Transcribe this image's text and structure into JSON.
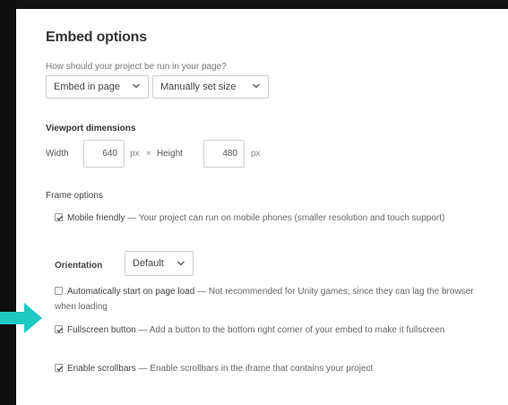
{
  "embed": {
    "title": "Embed options",
    "question": "How should your project be run in your page?",
    "embed_select": "Embed in page",
    "size_select": "Manually set size"
  },
  "viewport": {
    "title": "Viewport dimensions",
    "width_label": "Width",
    "width_value": "640",
    "width_unit": "px",
    "times": "×",
    "height_label": "Height",
    "height_value": "480",
    "height_unit": "px"
  },
  "frame": {
    "title": "Frame options",
    "mobile": {
      "checked": true,
      "title": "Mobile friendly",
      "desc": " — Your project can run on mobile phones (smaller resolution and touch support)"
    },
    "orientation_label": "Orientation",
    "orientation_value": "Default",
    "autostart": {
      "checked": false,
      "title": "Automatically start on page load",
      "desc": " — Not recommended for Unity games, since they can lag the browser when loading"
    },
    "fullscreen": {
      "checked": true,
      "title": "Fullscreen button",
      "desc": " — Add a button to the bottom right corner of your embed to make it fullscreen"
    },
    "scrollbars": {
      "checked": true,
      "title": "Enable scrollbars",
      "desc": " — Enable scrollbars in the iframe that contains your project"
    }
  },
  "colors": {
    "arrow": "#1ec9c4",
    "background": "#161616",
    "panel": "#ffffff"
  },
  "icons": {
    "dropdown": "chevron-down-icon",
    "check": "check-icon",
    "pointer": "arrow-right-icon"
  }
}
